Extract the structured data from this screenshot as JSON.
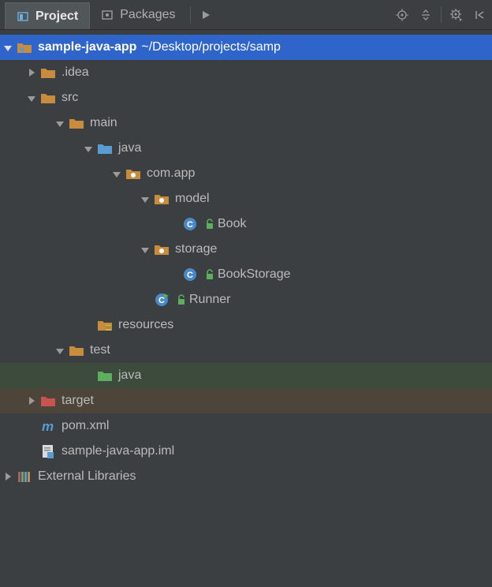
{
  "toolbar": {
    "tabs": [
      {
        "label": "Project",
        "active": true
      },
      {
        "label": "Packages",
        "active": false
      }
    ]
  },
  "tree": {
    "root": {
      "name": "sample-java-app",
      "path": "~/Desktop/projects/samp"
    },
    "idea": ".idea",
    "src": "src",
    "main": "main",
    "java": "java",
    "pkg": "com.app",
    "model": "model",
    "book": "Book",
    "storage": "storage",
    "bookstorage": "BookStorage",
    "runner": "Runner",
    "resources": "resources",
    "test": "test",
    "testjava": "java",
    "target": "target",
    "pom": "pom.xml",
    "iml": "sample-java-app.iml",
    "extlib": "External Libraries"
  }
}
